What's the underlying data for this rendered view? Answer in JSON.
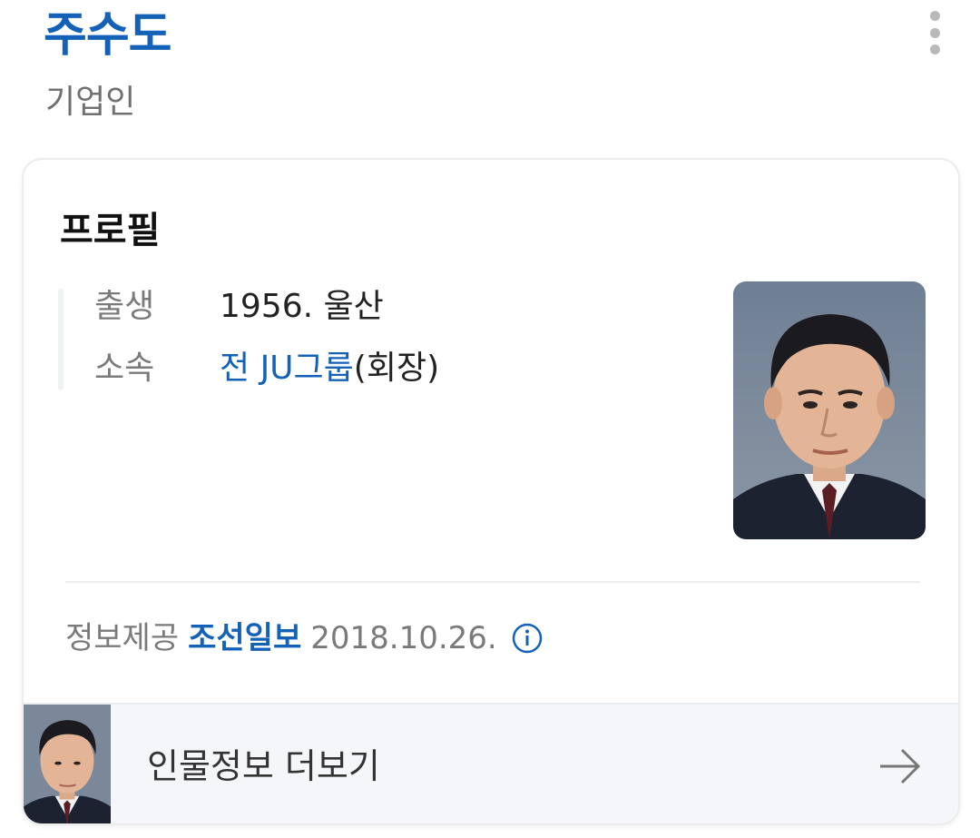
{
  "header": {
    "name": "주수도",
    "occupation": "기업인",
    "more_icon": "more-vertical-icon"
  },
  "profile": {
    "section_title": "프로필",
    "rows": [
      {
        "label": "출생",
        "value": "1956. 울산"
      },
      {
        "label": "소속",
        "link": "전 JU그룹",
        "suffix": "(회장)"
      }
    ],
    "photo": "portrait-photo"
  },
  "source": {
    "label": "정보제공",
    "provider": "조선일보",
    "date": "2018.10.26.",
    "icon": "info-icon"
  },
  "more": {
    "label": "인물정보 더보기",
    "icon": "arrow-right-icon"
  },
  "colors": {
    "accent": "#1462b8",
    "muted": "#7a7a7a",
    "card_border": "#ececec",
    "footer_bg": "#f4f6f9"
  }
}
